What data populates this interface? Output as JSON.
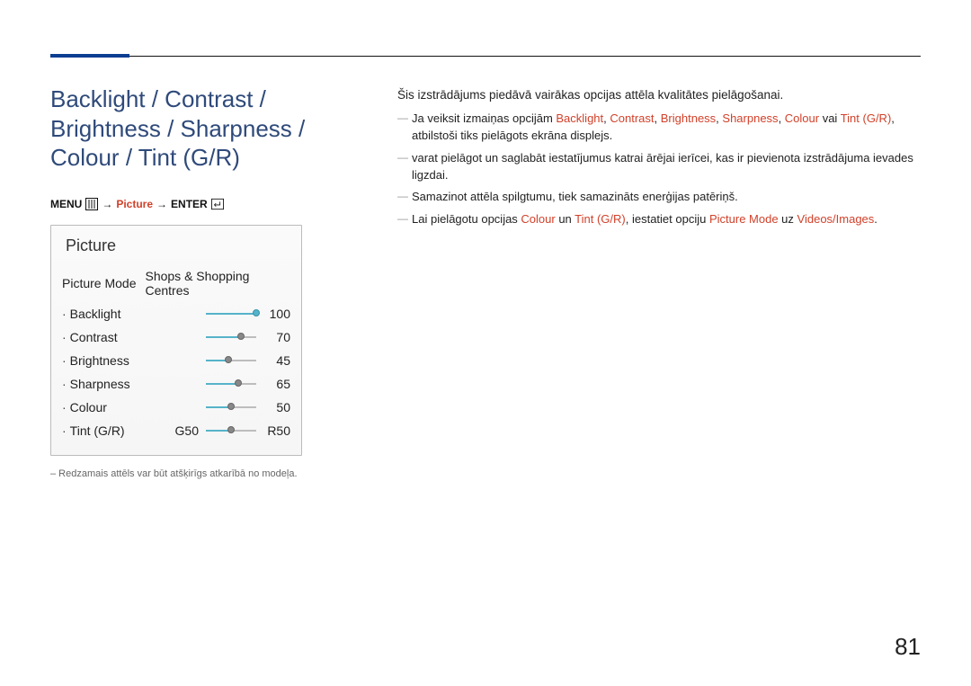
{
  "page_number": "81",
  "title": "Backlight / Contrast / Brightness / Sharpness / Colour / Tint (G/R)",
  "menupath": {
    "menu": "MENU",
    "section": "Picture",
    "enter": "ENTER",
    "arrow": "→"
  },
  "panel": {
    "title": "Picture",
    "picture_mode_label": "Picture Mode",
    "picture_mode_value": "Shops & Shopping Centres",
    "rows": [
      {
        "label": "Backlight",
        "value": "100",
        "pct": 100
      },
      {
        "label": "Contrast",
        "value": "70",
        "pct": 70
      },
      {
        "label": "Brightness",
        "value": "45",
        "pct": 45
      },
      {
        "label": "Sharpness",
        "value": "65",
        "pct": 65
      },
      {
        "label": "Colour",
        "value": "50",
        "pct": 50
      }
    ],
    "tint": {
      "label": "Tint (G/R)",
      "left": "G50",
      "right": "R50",
      "pct": 50
    }
  },
  "note": "– Redzamais attēls var būt atšķirīgs atkarībā no modeļa.",
  "right": {
    "intro": "Šis izstrādājums piedāvā vairākas opcijas attēla kvalitātes pielāgošanai.",
    "b1_pre": "Ja veiksit izmaiņas opcijām ",
    "b1_terms": [
      "Backlight",
      "Contrast",
      "Brightness",
      "Sharpness",
      "Colour"
    ],
    "b1_or": " vai ",
    "b1_last": "Tint (G/R)",
    "b1_post": ", atbilstoši tiks pielāgots ekrāna displejs.",
    "b2": "varat pielāgot un saglabāt iestatījumus katrai ārējai ierīcei, kas ir pievienota izstrādājuma ievades ligzdai.",
    "b3": "Samazinot attēla spilgtumu, tiek samazināts enerģijas patēriņš.",
    "b4_pre": "Lai pielāgotu opcijas ",
    "b4_a": "Colour",
    "b4_and": " un ",
    "b4_b": "Tint (G/R)",
    "b4_mid": ", iestatiet opciju ",
    "b4_c": "Picture Mode",
    "b4_to": " uz ",
    "b4_d": "Videos/Images",
    "b4_end": "."
  }
}
